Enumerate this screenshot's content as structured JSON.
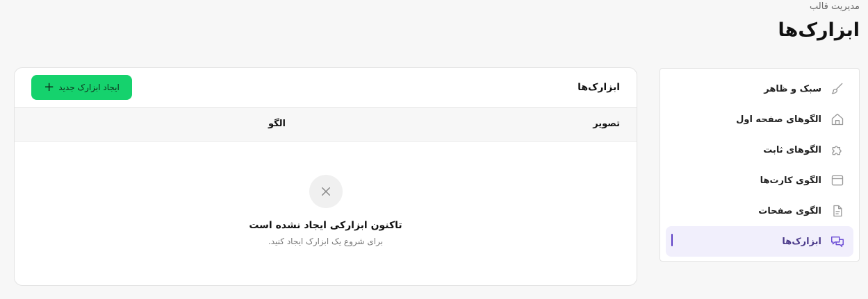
{
  "breadcrumb": "مدیریت قالب",
  "page_title": "ابزارک‌ها",
  "sidebar": {
    "items": [
      {
        "label": "سبک و ظاهر",
        "icon": "brush-icon",
        "active": false
      },
      {
        "label": "الگوهای صفحه اول",
        "icon": "home-icon",
        "active": false
      },
      {
        "label": "الگوهای ثابت",
        "icon": "puzzle-icon",
        "active": false
      },
      {
        "label": "الگوی کارت‌ها",
        "icon": "card-icon",
        "active": false
      },
      {
        "label": "الگوی صفحات",
        "icon": "document-icon",
        "active": false
      },
      {
        "label": "ابزارک‌ها",
        "icon": "chat-icon",
        "active": true
      }
    ]
  },
  "card": {
    "title": "ابزارک‌ها",
    "add_button": "ایجاد ابزارک جدید",
    "columns": {
      "image": "تصویر",
      "pattern": "الگو"
    },
    "empty": {
      "title": "تاکنون ابزارکی ایجاد نشده است",
      "subtitle": "برای شروع یک ابزارک ایجاد کنید."
    }
  },
  "colors": {
    "accent": "#15d26d",
    "active_bg": "#f1effc",
    "active_fg": "#4b3a8a"
  }
}
